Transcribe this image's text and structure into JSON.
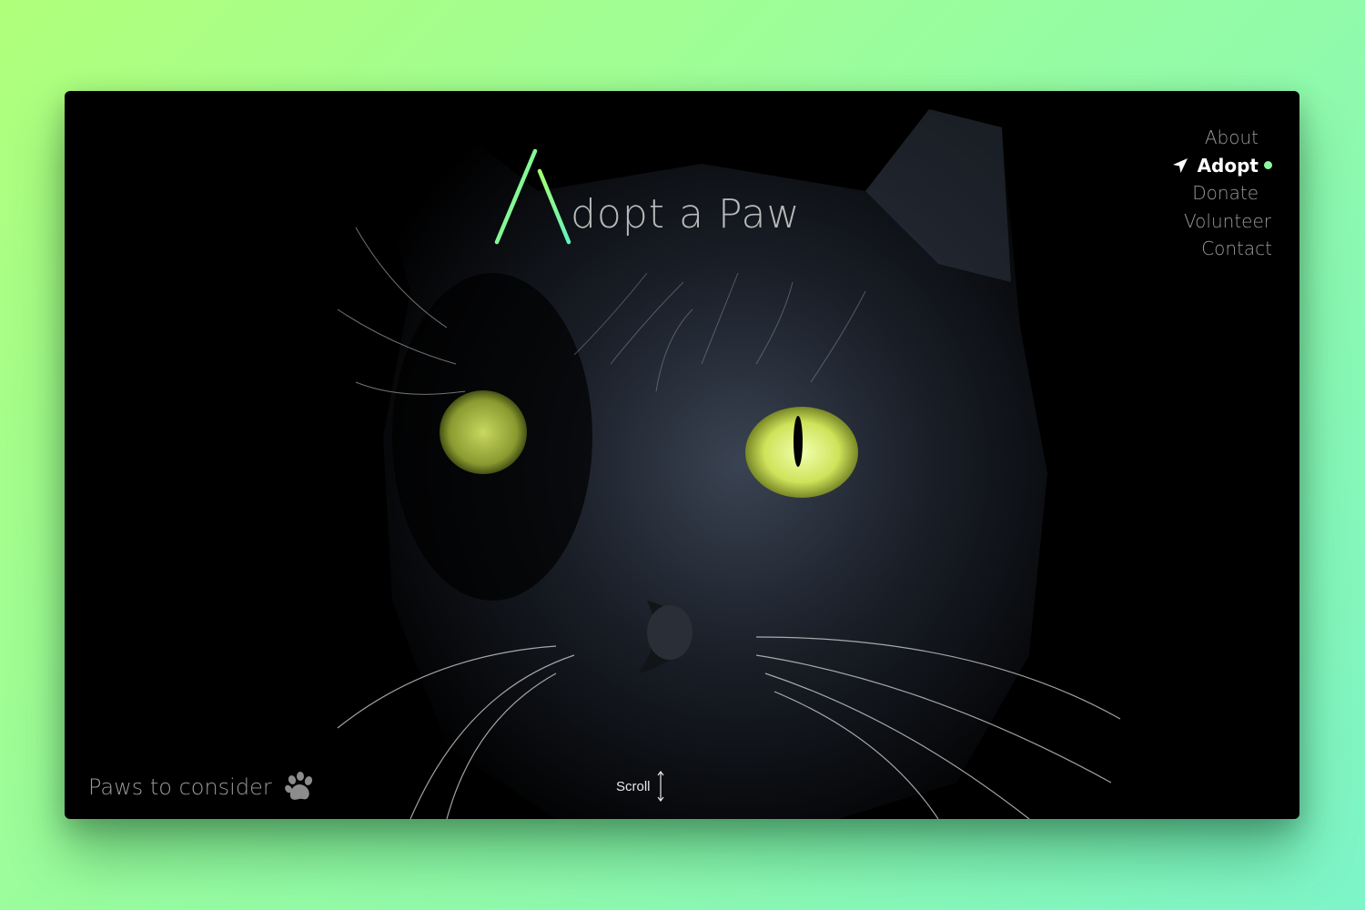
{
  "title": {
    "rest": "dopt a Paw",
    "accent_gradient": [
      "#a6ff6e",
      "#62f2c0"
    ]
  },
  "nav": {
    "items": [
      {
        "label": "About",
        "active": false
      },
      {
        "label": "Adopt",
        "active": true
      },
      {
        "label": "Donate",
        "active": false
      },
      {
        "label": "Volunteer",
        "active": false
      },
      {
        "label": "Contact",
        "active": false
      }
    ],
    "active_dot_color": "#8df7a0",
    "pointer_icon": "navigation-arrow-icon"
  },
  "footer": {
    "tagline": "Paws to consider",
    "tagline_icon": "paw-icon",
    "scroll_label": "Scroll",
    "scroll_icon": "scroll-arrows-icon"
  },
  "colors": {
    "background_start": "#b0ff7a",
    "background_end": "#7df5c8",
    "eye": "#d4f05a"
  }
}
